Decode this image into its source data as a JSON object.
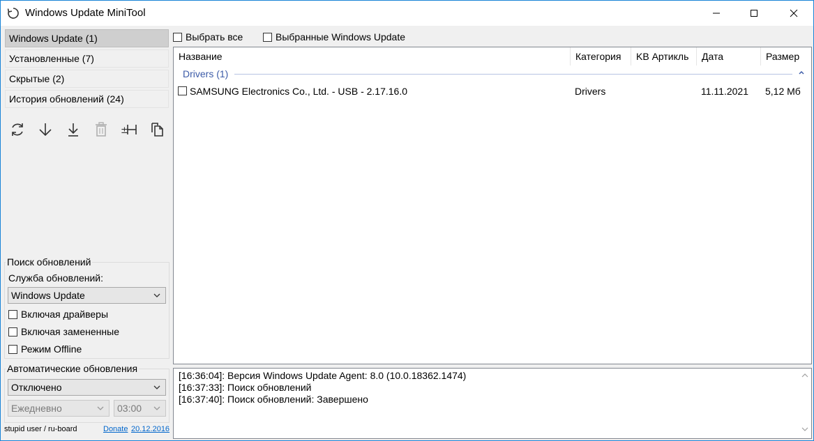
{
  "window": {
    "title": "Windows Update MiniTool",
    "icons": [
      "app-refresh-icon",
      "minimize-icon",
      "maximize-icon",
      "close-icon"
    ]
  },
  "nav": {
    "items": [
      {
        "label": "Windows Update (1)",
        "active": true
      },
      {
        "label": "Установленные (7)",
        "active": false
      },
      {
        "label": "Скрытые (2)",
        "active": false
      },
      {
        "label": "История обновлений (24)",
        "active": false
      }
    ]
  },
  "toolbar": {
    "icons": [
      "refresh-icon",
      "download-icon",
      "install-icon",
      "delete-icon",
      "hide-icon",
      "copy-icon"
    ]
  },
  "search": {
    "group_label": "Поиск обновлений",
    "service_label": "Служба обновлений:",
    "service_value": "Windows Update",
    "options": [
      {
        "label": "Включая драйверы",
        "checked": false
      },
      {
        "label": "Включая замененные",
        "checked": false
      },
      {
        "label": "Режим Offline",
        "checked": false
      }
    ]
  },
  "auto": {
    "group_label": "Автоматические обновления",
    "mode_value": "Отключено",
    "schedule_value": "Ежедневно",
    "time_value": "03:00"
  },
  "footer": {
    "credit": "stupid user / ru-board",
    "donate": "Donate",
    "date": "20.12.2016"
  },
  "top_checks": {
    "select_all": "Выбрать все",
    "selected_wu": "Выбранные Windows Update"
  },
  "list": {
    "columns": [
      "Название",
      "Категория",
      "KB Артикль",
      "Дата",
      "Размер"
    ],
    "group": "Drivers (1)",
    "rows": [
      {
        "name": "SAMSUNG Electronics Co., Ltd.  - USB - 2.17.16.0",
        "category": "Drivers",
        "kb": "",
        "date": "11.11.2021",
        "size": "5,12 Мб"
      }
    ]
  },
  "log": {
    "lines": [
      "[16:36:04]: Версия Windows Update Agent: 8.0 (10.0.18362.1474)",
      "[16:37:33]: Поиск обновлений",
      "[16:37:40]: Поиск обновлений: Завершено"
    ]
  }
}
